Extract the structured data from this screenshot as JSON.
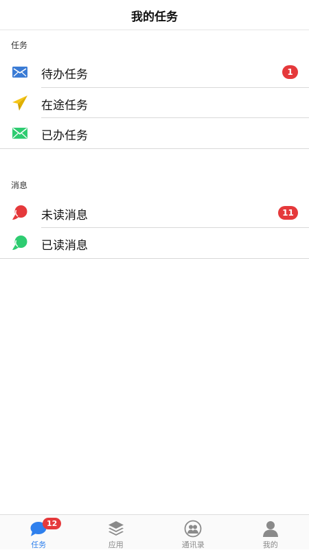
{
  "header": {
    "title": "我的任务"
  },
  "sections": {
    "tasks": {
      "title": "任务",
      "items": [
        {
          "label": "待办任务",
          "icon": "envelope-open-icon",
          "color": "#3a7bd5",
          "badge": "1"
        },
        {
          "label": "在途任务",
          "icon": "paper-plane-icon",
          "color": "#f5c518"
        },
        {
          "label": "已办任务",
          "icon": "envelope-icon",
          "color": "#2ecc71"
        }
      ]
    },
    "messages": {
      "title": "消息",
      "items": [
        {
          "label": "未读消息",
          "icon": "chat-bubble-red-icon",
          "color": "#e5393b",
          "badge": "11"
        },
        {
          "label": "已读消息",
          "icon": "chat-bubble-green-icon",
          "color": "#2ecc71"
        }
      ]
    }
  },
  "tabbar": {
    "tabs": [
      {
        "label": "任务",
        "icon": "chat-bubble-icon",
        "badge": "12",
        "active": true
      },
      {
        "label": "应用",
        "icon": "layers-icon"
      },
      {
        "label": "通讯录",
        "icon": "contacts-icon"
      },
      {
        "label": "我的",
        "icon": "person-icon"
      }
    ]
  },
  "colors": {
    "accent": "#2f80ed",
    "badge": "#e5393b"
  }
}
